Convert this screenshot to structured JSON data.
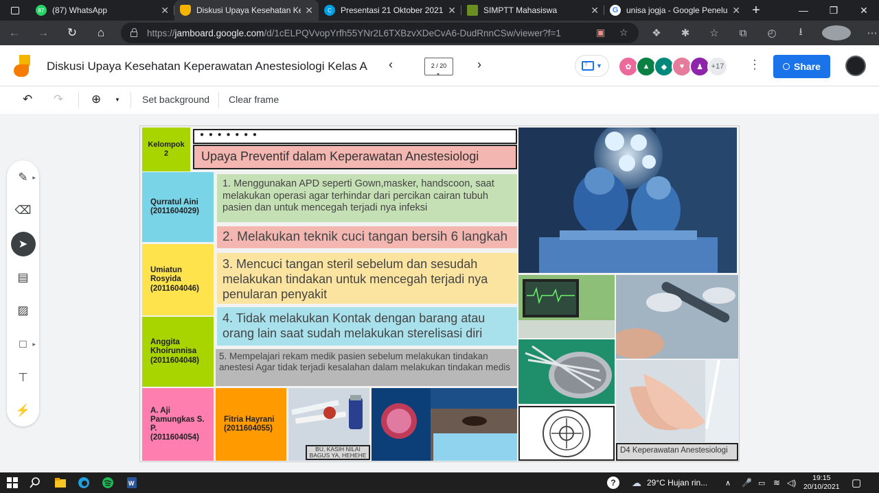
{
  "browser": {
    "tabs": [
      {
        "title": "(87) WhatsApp",
        "favicon_color": "#25d366",
        "favicon_text": "87",
        "active": false
      },
      {
        "title": "Diskusi Upaya Kesehatan Kep",
        "favicon_color": "#f4b400",
        "favicon_text": "",
        "active": true
      },
      {
        "title": "Presentasi 21 Oktober 2021 -",
        "favicon_color": "#00a0e3",
        "favicon_text": "C",
        "active": false
      },
      {
        "title": "SIMPTT Mahasiswa",
        "favicon_color": "#6b8e23",
        "favicon_text": "",
        "active": false
      },
      {
        "title": "unisa jogja - Google Penelus",
        "favicon_color": "#4285f4",
        "favicon_text": "G",
        "active": false
      }
    ],
    "url_prefix": "https://",
    "url_host": "jamboard.google.com",
    "url_path": "/d/1cELPQVvopYrfh55YNr2L6TXBzvXDeCvA6-DudRnnCSw/viewer?f=1"
  },
  "jam": {
    "title": "Diskusi Upaya Kesehatan Keperawatan Anestesiologi Kelas A",
    "frame_indicator": "2 / 20",
    "collaborators_more": "+17",
    "share_label": "Share",
    "toolbar": {
      "set_background": "Set background",
      "clear_frame": "Clear frame"
    }
  },
  "board": {
    "group_label": "Kelompok 2",
    "dots": "● ● ● ● ● ● ●",
    "title": "Upaya Preventif  dalam Keperawatan Anestesiologi",
    "members": [
      {
        "name": "Qurratul Aini (2011604029)"
      },
      {
        "name": "Umiatun Rosyida (2011604046)"
      },
      {
        "name": "Anggita Khoirunnisa (2011604048)"
      },
      {
        "name": "A. Aji Pamungkas S. P. (2011604054)"
      },
      {
        "name": "Fitria Hayrani (2011604055)"
      }
    ],
    "points": [
      "1. Menggunakan APD seperti Gown,masker, handscoon, saat melakukan operasi agar terhindar dari percikan cairan tubuh pasien dan untuk mencegah terjadi nya infeksi",
      "2. Melakukan teknik cuci tangan bersih 6 langkah",
      "3. Mencuci tangan steril sebelum dan sesudah melakukan tindakan untuk mencegah terjadi nya penularan penyakit",
      "4. Tidak melakukan Kontak dengan barang atau orang lain saat sudah melakukan sterelisasi diri",
      "5. Mempelajari rekam medik pasien sebelum melakukan tindakan anestesi Agar tidak terjadi kesalahan dalam melakukan tindakan medis"
    ],
    "caption_syringe": "BU, KASIH NILAI BAGUS YA, HEHEHE",
    "caption_program": "D4 Keperawatan Anestesiologi"
  },
  "taskbar": {
    "weather": "29°C  Hujan rin...",
    "time": "19:15",
    "date": "20/10/2021"
  },
  "colors": {
    "lime": "#a8d400",
    "cyan": "#79d4e8",
    "yellow": "#ffe34d",
    "pink": "#ff7eb0",
    "orange": "#ff9a00",
    "note_green": "#c5e0b4",
    "note_pink": "#f4b6b0",
    "note_yellow": "#fbe3a0",
    "note_cyan": "#a8e0ec",
    "note_gray": "#b8b8b8"
  }
}
